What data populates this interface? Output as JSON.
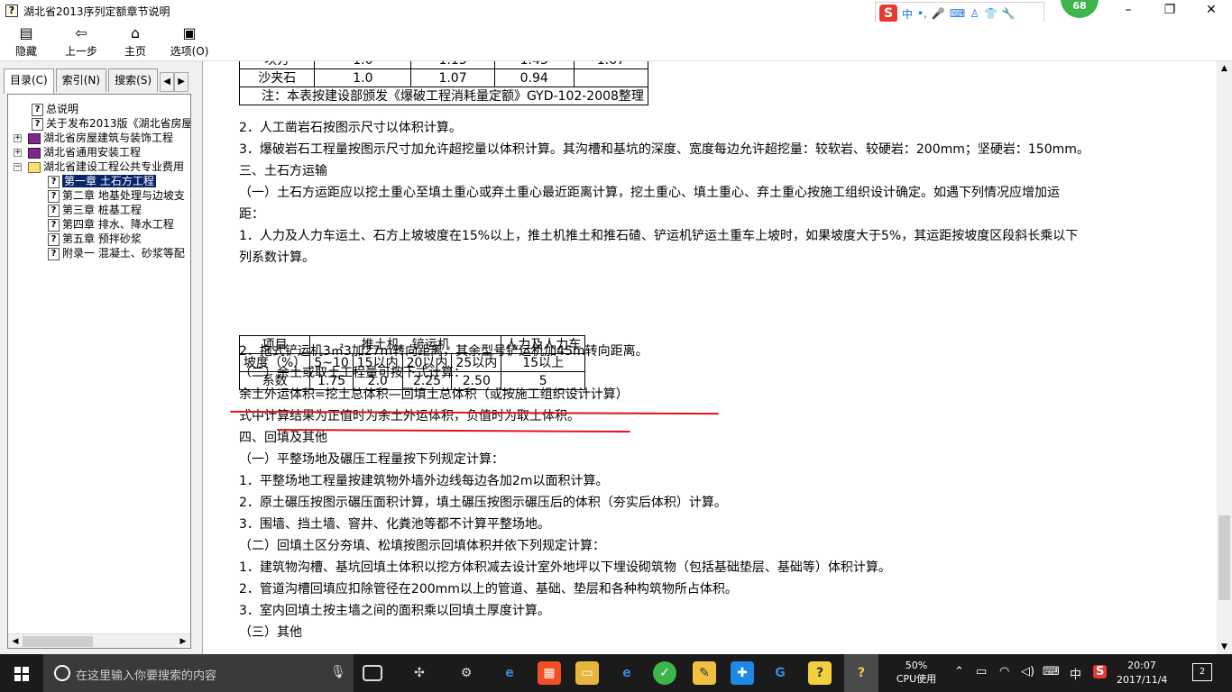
{
  "window": {
    "title": "湖北省2013序列定额章节说明",
    "app_icon": "help-book-icon",
    "minimize": "–",
    "maximize": "❐",
    "close": "✕"
  },
  "ime": {
    "logo": "S",
    "items": [
      "中",
      "•",
      "mic",
      "keyboard",
      "user",
      "shirt",
      "wrench"
    ],
    "badge": "68"
  },
  "toolbar": {
    "hide": "隐藏",
    "back": "上一步",
    "home": "主页",
    "options": "选项(O)"
  },
  "left": {
    "tabs": [
      "目录(C)",
      "索引(N)",
      "搜索(S)"
    ],
    "tree": [
      {
        "label": "总说明",
        "icon": "question",
        "level": 1
      },
      {
        "label": "关于发布2013版《湖北省房屋",
        "icon": "question",
        "level": 1
      },
      {
        "label": "湖北省房屋建筑与装饰工程",
        "icon": "book",
        "level": 0,
        "expander": "+"
      },
      {
        "label": "湖北省通用安装工程",
        "icon": "book",
        "level": 0,
        "expander": "+"
      },
      {
        "label": "湖北省建设工程公共专业费用",
        "icon": "book-open",
        "level": 0,
        "expander": "−"
      },
      {
        "label": "第一章 土石方工程",
        "icon": "question",
        "level": 2,
        "selected": true
      },
      {
        "label": "第二章 地基处理与边坡支",
        "icon": "question",
        "level": 2
      },
      {
        "label": "第三章 桩基工程",
        "icon": "question",
        "level": 2
      },
      {
        "label": "第四章 排水、降水工程",
        "icon": "question",
        "level": 2
      },
      {
        "label": "第五章 预拌砂浆",
        "icon": "question",
        "level": 2
      },
      {
        "label": "附录一 混凝土、砂浆等配",
        "icon": "question",
        "level": 2
      }
    ]
  },
  "doc": {
    "top_table": {
      "rows": [
        [
          "坎方",
          "1.0",
          "1.15",
          "1.43",
          "1.67"
        ],
        [
          "沙夹石",
          "1.0",
          "1.07",
          "0.94",
          ""
        ]
      ],
      "note": "注：本表按建设部颁发《爆破工程消耗量定额》GYD-102-2008整理"
    },
    "lines_a": [
      "2．人工凿岩石按图示尺寸以体积计算。",
      "3．爆破岩石工程量按图示尺寸加允许超挖量以体积计算。其沟槽和基坑的深度、宽度每边允许超挖量：较软岩、较硬岩：200mm；坚硬岩：150mm。",
      "三、土石方运输",
      "（一）土石方运距应以挖土重心至填土重心或弃土重心最近距离计算，挖土重心、填土重心、弃土重心按施工组织设计确定。如遇下列情况应增加运",
      "距：",
      "1．人力及人力车运土、石方上坡坡度在15%以上，推土机推土和推石碴、铲运机铲运土重车上坡时，如果坡度大于5%，其运距按坡度区段斜长乘以下",
      "列系数计算。"
    ],
    "slope_table": {
      "header": [
        "项目",
        "推土机、铲运机",
        "人力及人力车"
      ],
      "row_slope": [
        "坡度（%）",
        "5~10",
        "15以内",
        "20以内",
        "25以内",
        "15以上"
      ],
      "row_coef": [
        "系数",
        "1.75",
        "2.0",
        "2.25",
        "2.50",
        "5"
      ]
    },
    "lines_b": [
      "2．拖式铲运机3㎡3加27m转向距离，其余型号铲运机加45m转向距离。",
      "（二）余土或取土工程量可按下式计算：",
      "余土外运体积=挖土总体积—回填土总体积（或按施工组织设计计算）",
      "式中计算结果为正值时为余土外运体积，负值时为取土体积。",
      "四、回填及其他",
      "（一）平整场地及碾压工程量按下列规定计算：",
      "1．平整场地工程量按建筑物外墙外边线每边各加2m以面积计算。",
      "2．原土碾压按图示碾压面积计算，填土碾压按图示碾压后的体积（夯实后体积）计算。",
      "3．围墙、挡土墙、窨井、化粪池等都不计算平整场地。",
      "（二）回填土区分夯填、松填按图示回填体积并依下列规定计算：",
      "1．建筑物沟槽、基坑回填土体积以挖方体积减去设计室外地坪以下埋设砌筑物（包括基础垫层、基础等）体积计算。",
      "2．管道沟槽回填应扣除管径在200mm以上的管道、基础、垫层和各种构筑物所占体积。",
      "3．室内回填土按主墙之间的面积乘以回填土厚度计算。",
      "（三）其他"
    ],
    "highlight_color": "#e0141e"
  },
  "taskbar": {
    "search_placeholder": "在这里输入你要搜索的内容",
    "cpu_percent": "50%",
    "cpu_label": "CPU使用",
    "ime_lang": "中",
    "time": "20:07",
    "date": "2017/11/4",
    "notifications": "2"
  }
}
